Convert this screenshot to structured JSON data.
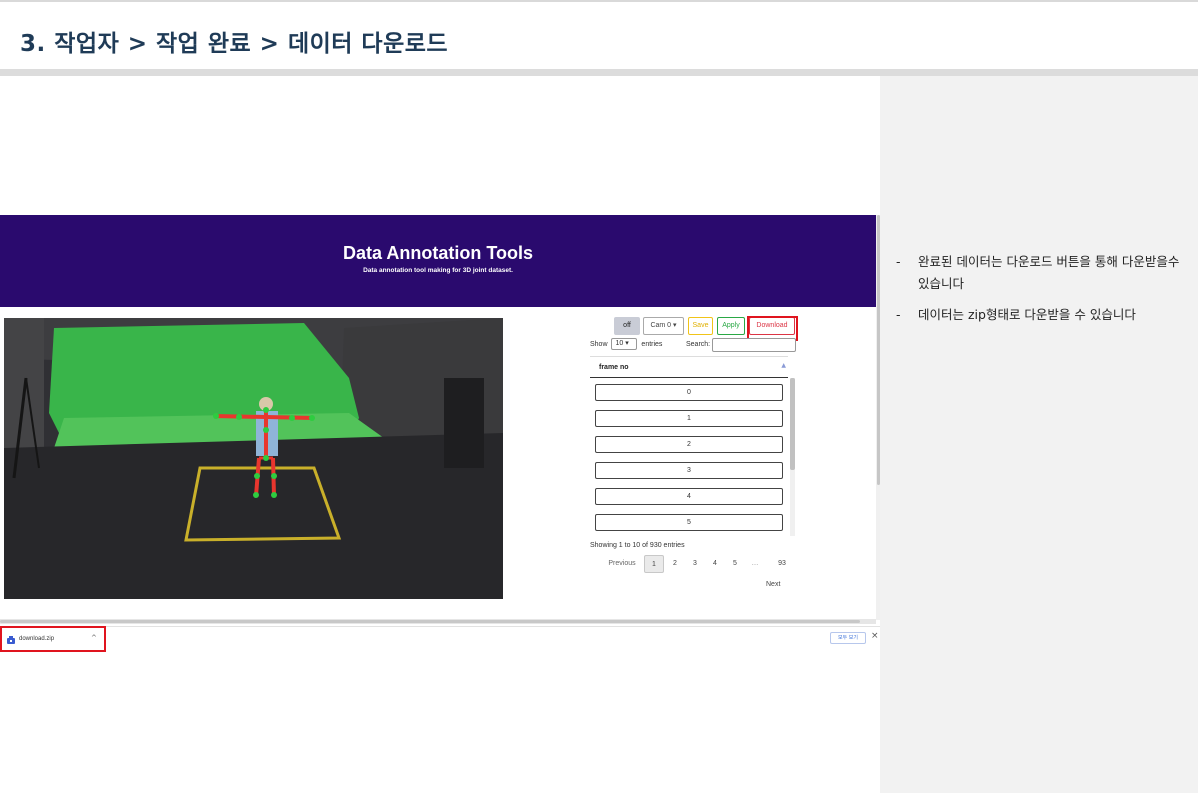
{
  "slide": {
    "title": "3. 작업자 > 작업 완료 > 데이터 다운로드",
    "notes": [
      {
        "bullet": "-",
        "text": "완료된 데이터는 다운로드 버튼을 통해 다운받을수 있습니다"
      },
      {
        "bullet": "-",
        "text": "데이터는 zip형태로 다운받을 수 있습니다"
      }
    ]
  },
  "app": {
    "title": "Data Annotation Tools",
    "subtitle": "Data annotation tool making for 3D joint dataset.",
    "header_color": "#2a0a6e"
  },
  "toolbar": {
    "off_label": "off",
    "cam_label": "Cam 0",
    "cam_caret": "▾",
    "save_label": "Save",
    "apply_label": "Apply",
    "download_label": "Download"
  },
  "table": {
    "show_label": "Show",
    "page_size": "10",
    "entries_label": "entries",
    "search_label": "Search:",
    "column": "frame no",
    "rows": [
      "0",
      "1",
      "2",
      "3",
      "4",
      "5"
    ],
    "info": "Showing 1 to 10 of 930 entries",
    "pagination": {
      "previous": "Previous",
      "pages": [
        "1",
        "2",
        "3",
        "4",
        "5",
        "…",
        "93"
      ],
      "next": "Next"
    }
  },
  "download_bar": {
    "file_name": "download.zip",
    "chevron": "^",
    "show_all": "모두 보기",
    "close": "×"
  },
  "colors": {
    "highlight": "#e0141e",
    "save": "#e0b000",
    "apply": "#2aa845",
    "download": "#dc3545"
  }
}
